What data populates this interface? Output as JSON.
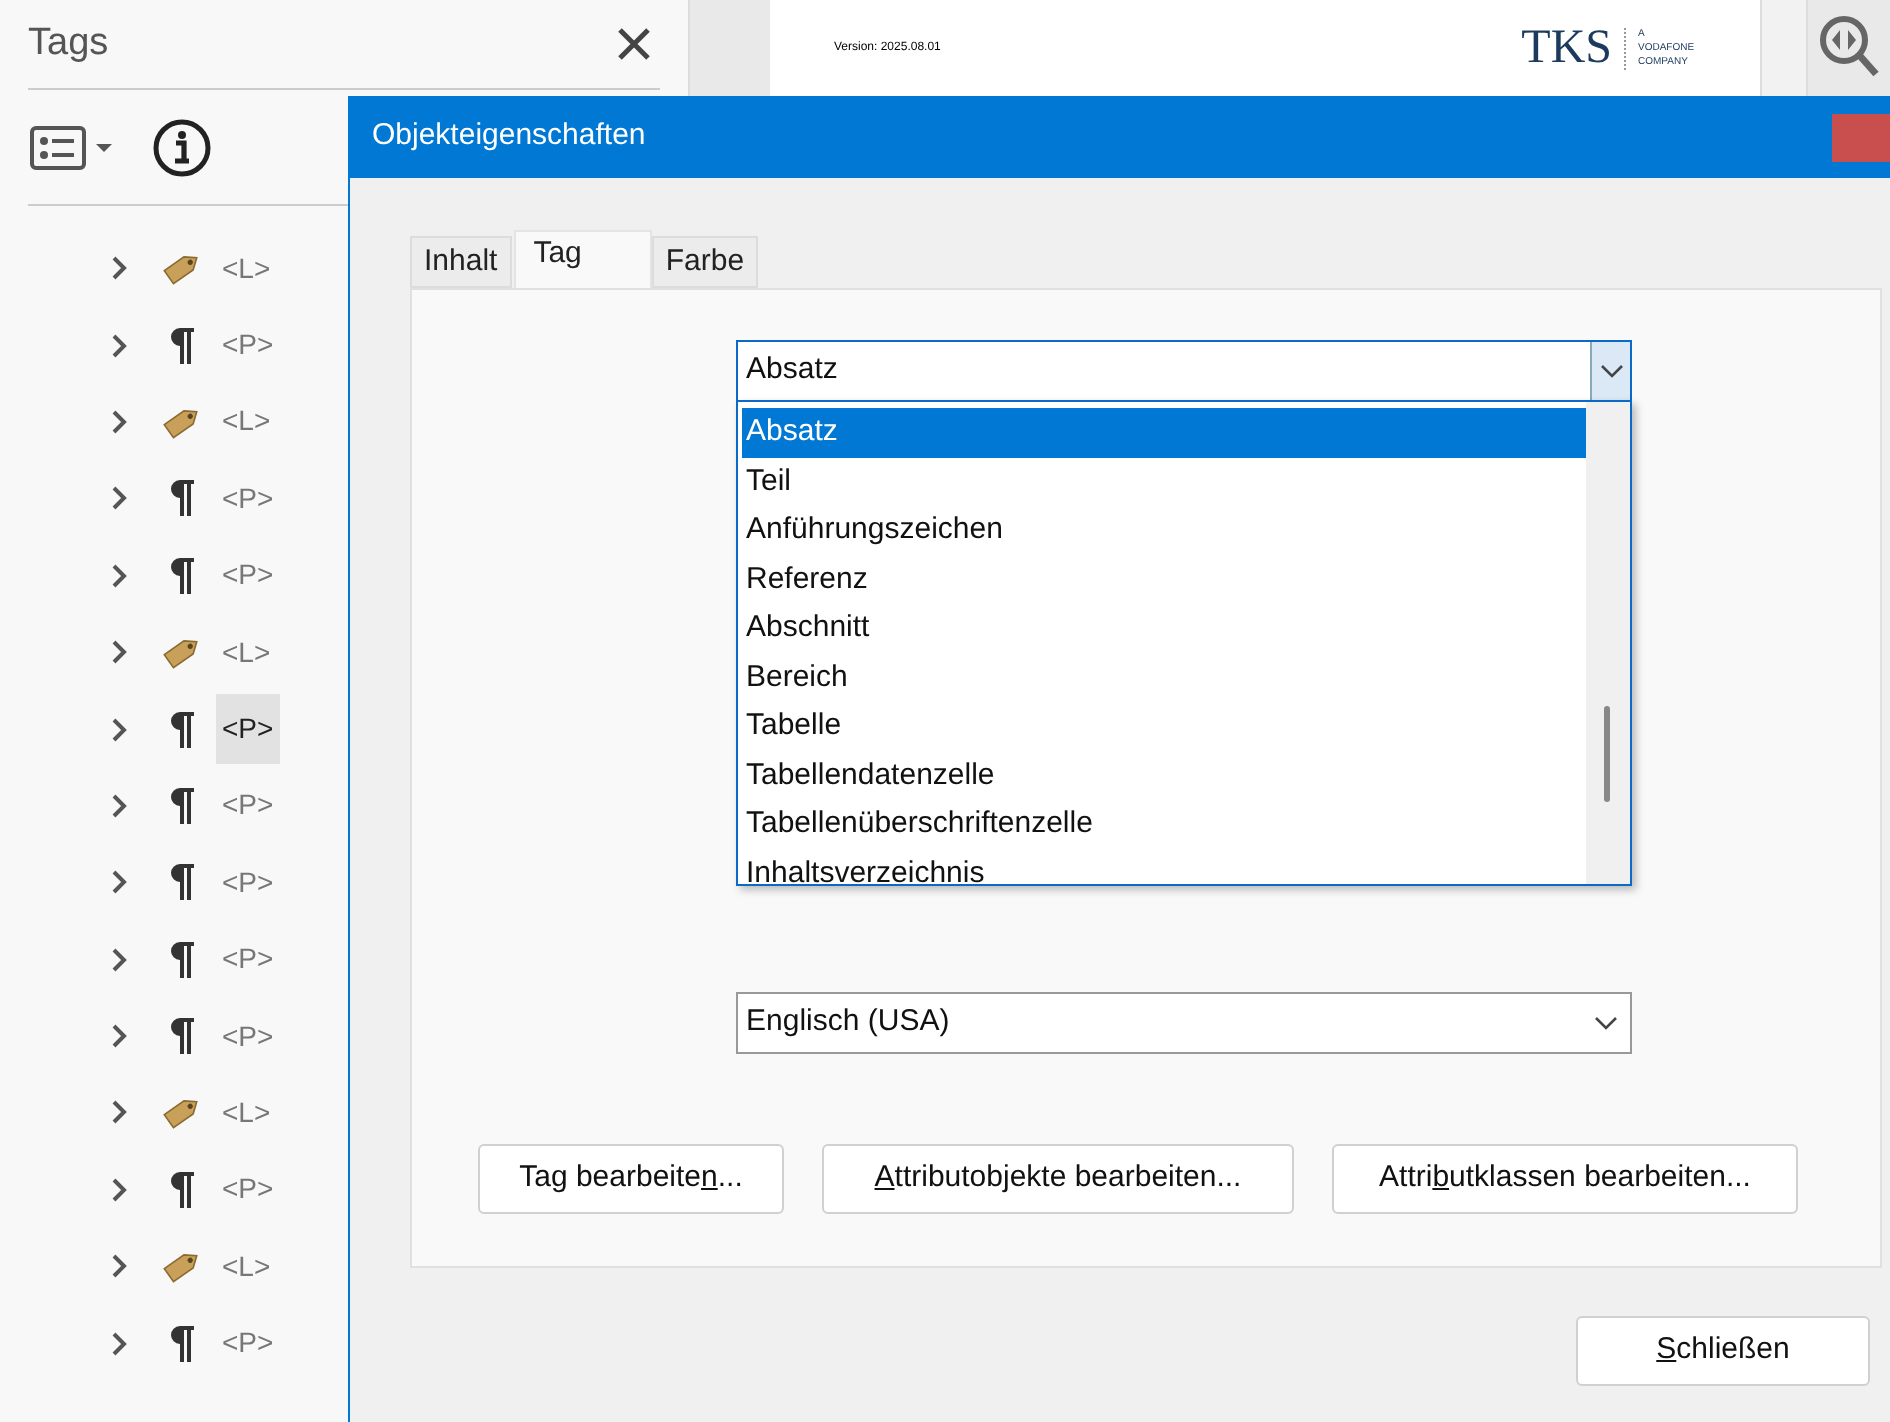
{
  "panel": {
    "title": "Tags",
    "tree": [
      {
        "kind": "list",
        "label": "<L>",
        "selected": false,
        "expanded": false
      },
      {
        "kind": "paragraph",
        "label": "<P>",
        "selected": false,
        "expanded": false
      },
      {
        "kind": "list",
        "label": "<L>",
        "selected": false,
        "expanded": false
      },
      {
        "kind": "paragraph",
        "label": "<P>",
        "selected": false,
        "expanded": false
      },
      {
        "kind": "paragraph",
        "label": "<P>",
        "selected": false,
        "expanded": false
      },
      {
        "kind": "list",
        "label": "<L>",
        "selected": false,
        "expanded": false
      },
      {
        "kind": "paragraph",
        "label": "<P>",
        "selected": true,
        "expanded": false
      },
      {
        "kind": "paragraph",
        "label": "<P>",
        "selected": false,
        "expanded": false
      },
      {
        "kind": "paragraph",
        "label": "<P>",
        "selected": false,
        "expanded": false
      },
      {
        "kind": "paragraph",
        "label": "<P>",
        "selected": false,
        "expanded": false
      },
      {
        "kind": "paragraph",
        "label": "<P>",
        "selected": false,
        "expanded": false
      },
      {
        "kind": "list",
        "label": "<L>",
        "selected": false,
        "expanded": false
      },
      {
        "kind": "paragraph",
        "label": "<P>",
        "selected": false,
        "expanded": false
      },
      {
        "kind": "list",
        "label": "<L>",
        "selected": false,
        "expanded": false
      },
      {
        "kind": "paragraph",
        "label": "<P>",
        "selected": false,
        "expanded": false
      }
    ]
  },
  "document": {
    "version": "Version: 2025.08.01",
    "logo": "TKS",
    "logo_tagline": "A VODAFONE COMPANY"
  },
  "dialog": {
    "title": "Objekteigenschaften",
    "tabs": [
      {
        "label": "Inhalt",
        "selected": false
      },
      {
        "label": "Tag",
        "selected": true
      },
      {
        "label": "Farbe",
        "selected": false
      }
    ],
    "type_combo": {
      "value": "Absatz",
      "open": true,
      "options": [
        {
          "label": "Absatz",
          "selected": true
        },
        {
          "label": "Teil",
          "selected": false
        },
        {
          "label": "Anführungszeichen",
          "selected": false
        },
        {
          "label": "Referenz",
          "selected": false
        },
        {
          "label": "Abschnitt",
          "selected": false
        },
        {
          "label": "Bereich",
          "selected": false
        },
        {
          "label": "Tabelle",
          "selected": false
        },
        {
          "label": "Tabellendatenzelle",
          "selected": false
        },
        {
          "label": "Tabellenüberschriftenzelle",
          "selected": false
        },
        {
          "label": "Inhaltsverzeichnis",
          "selected": false
        }
      ]
    },
    "language_combo": {
      "value": "Englisch (USA)"
    },
    "buttons": [
      {
        "pre": "Tag bearbeite",
        "key": "n",
        "post": "..."
      },
      {
        "key": "A",
        "post": "ttributobjekte bearbeiten..."
      },
      {
        "pre": "Attri",
        "key": "b",
        "post": "utklassen bearbeiten..."
      }
    ],
    "close_button": {
      "key": "S",
      "post": "chließen"
    }
  }
}
